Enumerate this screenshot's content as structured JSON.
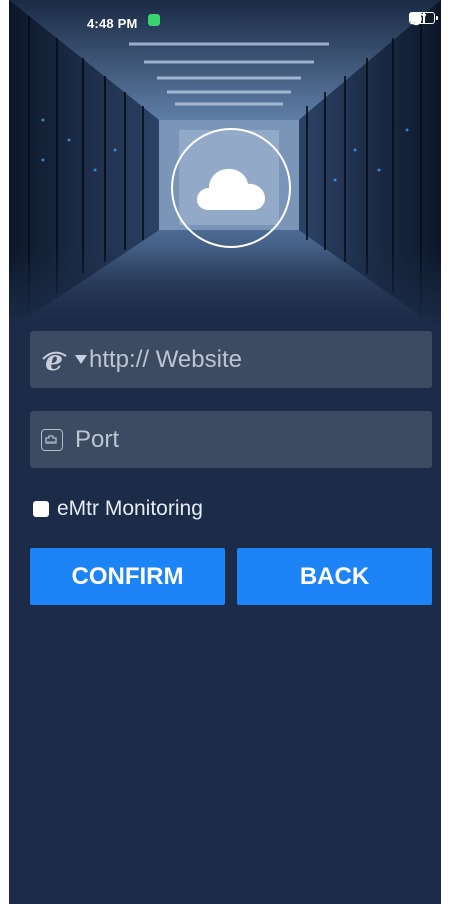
{
  "status_bar": {
    "time": "4:48 PM",
    "battery": "67",
    "icons": [
      "notification-app-icon",
      "mute-icon",
      "alarm-icon",
      "hd-icon",
      "signal-4g-icon",
      "hd-icon",
      "signal-4g-icon",
      "wifi-icon",
      "battery-icon"
    ]
  },
  "form": {
    "website_placeholder": "http:// Website",
    "port_placeholder": "Port",
    "monitoring_label": "eMtr Monitoring",
    "monitoring_checked": false
  },
  "buttons": {
    "confirm": "CONFIRM",
    "back": "BACK"
  },
  "colors": {
    "background": "#1c2c48",
    "field": "#3d4b62",
    "button": "#1c84f6",
    "text": "#ffffff"
  }
}
